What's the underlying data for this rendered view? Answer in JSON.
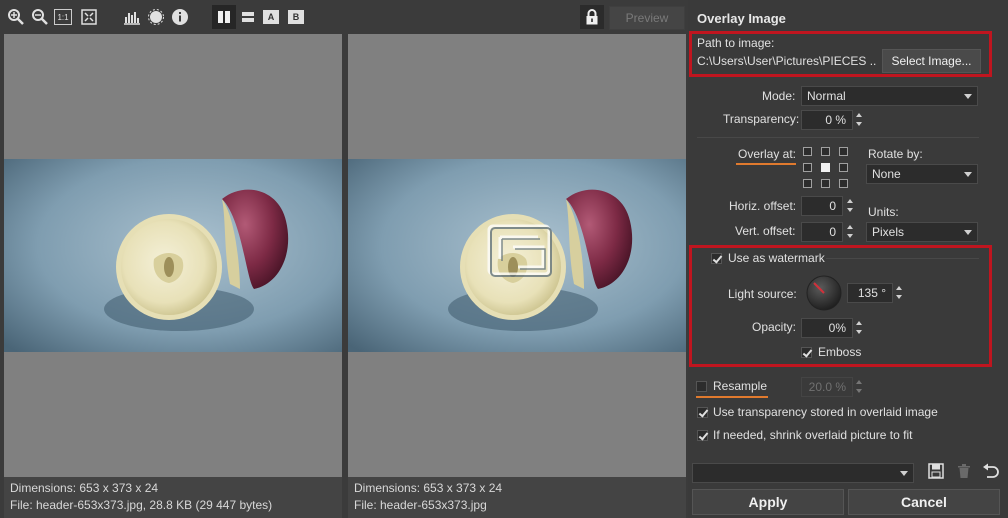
{
  "toolbar": {
    "zoom_reset_label": "1:1",
    "seg_a_label": "A",
    "seg_b_label": "B",
    "preview_label": "Preview"
  },
  "left_view": {
    "dimensions": "Dimensions: 653 x 373 x 24",
    "file": "File: header-653x373.jpg, 28.8 KB (29 447 bytes)"
  },
  "right_view": {
    "dimensions": "Dimensions: 653 x 373 x 24",
    "file": "File: header-653x373.jpg"
  },
  "panel": {
    "title": "Overlay Image",
    "path_label": "Path to image:",
    "path_value": "C:\\Users\\User\\Pictures\\PIECES ...",
    "select_image_label": "Select Image...",
    "mode_label": "Mode:",
    "mode_value": "Normal",
    "transparency_label": "Transparency:",
    "transparency_value": "0 %",
    "overlay_at_label": "Overlay at:",
    "rotate_by_label": "Rotate by:",
    "rotate_value": "None",
    "horiz_offset_label": "Horiz. offset:",
    "horiz_offset_value": "0",
    "vert_offset_label": "Vert. offset:",
    "vert_offset_value": "0",
    "units_label": "Units:",
    "units_value": "Pixels",
    "watermark_label": "Use as watermark",
    "light_source_label": "Light source:",
    "light_source_value": "135 °",
    "opacity_label": "Opacity:",
    "opacity_value": "0%",
    "emboss_label": "Emboss",
    "resample_label": "Resample",
    "resample_value": "20.0 %",
    "use_transparency_label": "Use transparency stored in overlaid image",
    "shrink_label": "If needed, shrink overlaid picture to fit",
    "preset_value": "",
    "apply_label": "Apply",
    "cancel_label": "Cancel"
  },
  "colors": {
    "highlight_box": "#c0151f",
    "underline_accent": "#e07a2e"
  }
}
